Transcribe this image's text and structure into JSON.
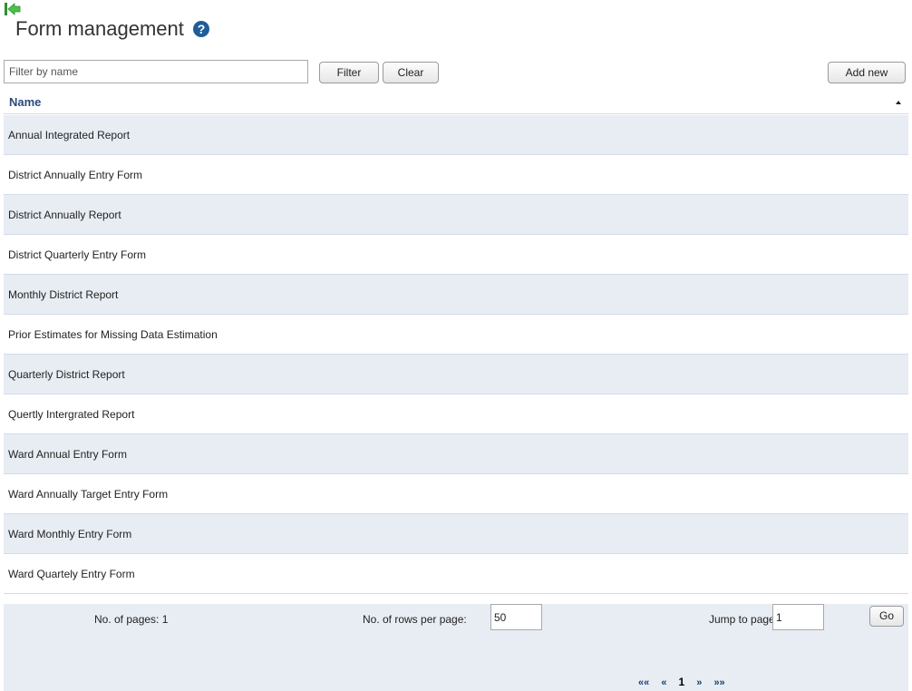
{
  "header": {
    "title": "Form management",
    "help_icon": "question-circle-icon",
    "back_icon": "back-arrow-icon"
  },
  "toolbar": {
    "filter_placeholder": "Filter by name",
    "filter_value": "",
    "filter_label": "Filter",
    "clear_label": "Clear",
    "add_label": "Add new"
  },
  "table": {
    "column_header": "Name",
    "sort_direction": "ascending",
    "rows": [
      "Annual Integrated Report",
      "District Annually Entry Form",
      "District Annually Report",
      "District Quarterly Entry Form",
      "Monthly District Report",
      "Prior Estimates for Missing Data Estimation",
      "Quarterly District Report",
      "Quertly Intergrated Report",
      "Ward Annual Entry Form",
      "Ward Annually Target Entry Form",
      "Ward Monthly Entry Form",
      "Ward Quartely Entry Form"
    ]
  },
  "footer": {
    "pages_label": "No. of pages: 1",
    "rows_per_page_label": "No. of rows per page:",
    "rows_per_page_value": "50",
    "jump_label": "Jump to page:",
    "jump_value": "1",
    "go_label": "Go",
    "pager": {
      "first": "««",
      "prev": "«",
      "current": "1",
      "next": "»",
      "last": "»»"
    }
  },
  "colors": {
    "row_alt": "#e8edf4",
    "header_text": "#2a4a7b",
    "help_icon_bg": "#1f5d9a",
    "back_icon": "#3aa83a"
  }
}
